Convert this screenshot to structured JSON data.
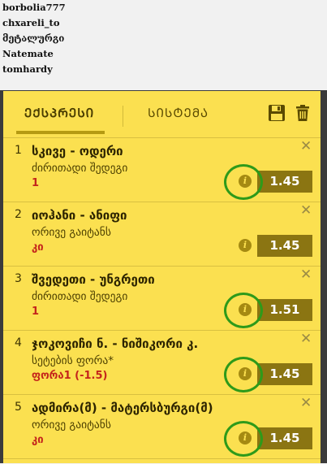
{
  "users": [
    "borbolia777",
    "chxareli_to",
    "მეტალურგი",
    "Natemate",
    "tomhardy"
  ],
  "tabs": {
    "express": "ᲔᲥᲡᲞᲠᲔᲡᲘ",
    "system": "ᲡᲘᲡᲢᲔᲛᲐ"
  },
  "icons": {
    "save": "save-icon",
    "delete": "trash-icon",
    "info": "info-icon",
    "close": "close-icon"
  },
  "colors": {
    "panel": "#fbe050",
    "odds_bg": "#8b7512",
    "outcome": "#c4241b",
    "highlight_ring": "#2e9a1a"
  },
  "bets": [
    {
      "num": "1",
      "title": "სკივე - ოდერი",
      "market": "ძირითადი შედეგი",
      "outcome": "1",
      "odds": "1.45",
      "highlighted": true
    },
    {
      "num": "2",
      "title": "იოჰანი - ანიფი",
      "market": "ორივე გაიტანს",
      "outcome": "კი",
      "odds": "1.45",
      "highlighted": false
    },
    {
      "num": "3",
      "title": "შვედეთი - უნგრეთი",
      "market": "ძირითადი შედეგი",
      "outcome": "1",
      "odds": "1.51",
      "highlighted": true
    },
    {
      "num": "4",
      "title": "ჯოკოვიჩი ნ. - ნიშიკორი კ.",
      "market": "სეტების ფორა*",
      "outcome": "ფორა1 (-1.5)",
      "odds": "1.45",
      "highlighted": true
    },
    {
      "num": "5",
      "title": "ადმირა(მ) - მატერსბურგი(მ)",
      "market": "ორივე გაიტანს",
      "outcome": "კი",
      "odds": "1.45",
      "highlighted": true
    }
  ]
}
